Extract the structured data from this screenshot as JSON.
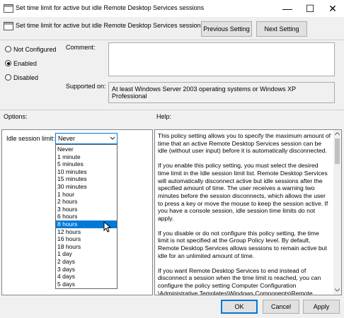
{
  "window": {
    "title": "Set time limit for active but idle Remote Desktop Services sessions",
    "controls": [
      "—",
      "☐",
      "✕"
    ]
  },
  "header": {
    "policy_name": "Set time limit for active but idle Remote Desktop Services sessions",
    "previous_label": "Previous Setting",
    "next_label": "Next Setting"
  },
  "state": {
    "options": [
      "Not Configured",
      "Enabled",
      "Disabled"
    ],
    "selected": "Enabled"
  },
  "comment": {
    "label": "Comment:",
    "value": ""
  },
  "supported": {
    "label": "Supported on:",
    "value": "At least Windows Server 2003 operating systems or Windows XP Professional"
  },
  "sections": {
    "options_label": "Options:",
    "help_label": "Help:"
  },
  "idle_limit": {
    "label": "Idle session limit:",
    "value": "Never",
    "dropdown_items": [
      "Never",
      "1 minute",
      "5 minutes",
      "10 minutes",
      "15 minutes",
      "30 minutes",
      "1 hour",
      "2 hours",
      "3 hours",
      "6 hours",
      "8 hours",
      "12 hours",
      "16 hours",
      "18 hours",
      "1 day",
      "2 days",
      "3 days",
      "4 days",
      "5 days"
    ],
    "highlighted": "8 hours"
  },
  "help": {
    "p1": "This policy setting allows you to specify the maximum amount of time that an active Remote Desktop Services session can be idle (without user input) before it is automatically disconnected.",
    "p2": "If you enable this policy setting, you must select the desired time limit in the Idle session limit list. Remote Desktop Services will automatically disconnect active but idle sessions after the specified amount of time. The user receives a warning two minutes before the session disconnects, which allows the user to press a key or move the mouse to keep the session active. If you have a console session, idle session time limits do not apply.",
    "p3": "If you disable or do not configure this policy setting, the time limit is not specified at the Group Policy level. By default, Remote Desktop Services allows sessions to remain active but idle for an unlimited amount of time.",
    "p4": "If you want Remote Desktop Services to end instead of disconnect a session when the time limit is reached, you can configure the policy setting Computer Configuration \\Administrative Templates\\Windows Components\\Remote Desktop Services\\Remote Desktop Session Host\\Session Time..."
  },
  "footer": {
    "ok_label": "OK",
    "cancel_label": "Cancel",
    "apply_label": "Apply"
  }
}
